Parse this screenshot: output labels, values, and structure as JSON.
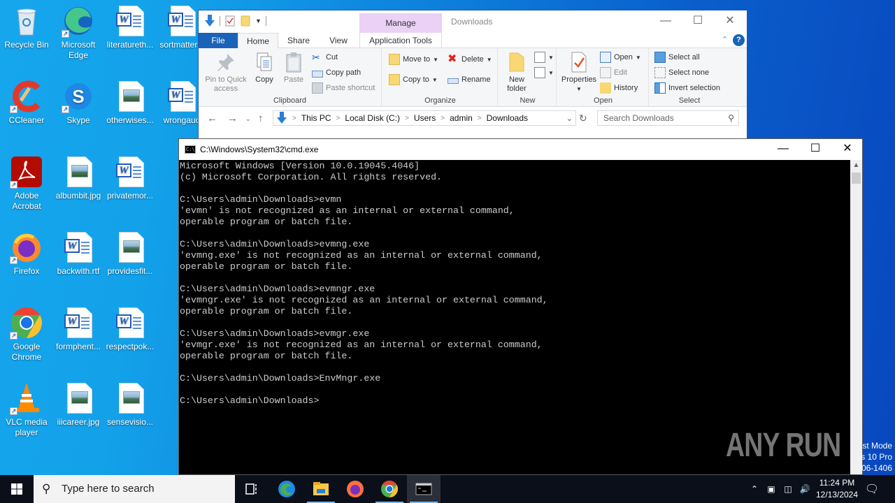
{
  "desktop": {
    "icons": [
      {
        "label": "Recycle Bin",
        "kind": "recycle-bin"
      },
      {
        "label": "Microsoft Edge",
        "kind": "edge"
      },
      {
        "label": "literatureth...",
        "kind": "word"
      },
      {
        "label": "sortmatter...",
        "kind": "word"
      },
      {
        "label": "CCleaner",
        "kind": "ccleaner"
      },
      {
        "label": "Skype",
        "kind": "skype"
      },
      {
        "label": "otherwises...",
        "kind": "image"
      },
      {
        "label": "wrongaud",
        "kind": "word"
      },
      {
        "label": "Adobe Acrobat",
        "kind": "acrobat"
      },
      {
        "label": "albumbit.jpg",
        "kind": "image"
      },
      {
        "label": "privatemor...",
        "kind": "word"
      },
      {
        "label": "Firefox",
        "kind": "firefox"
      },
      {
        "label": "backwith.rtf",
        "kind": "word"
      },
      {
        "label": "providesfit...",
        "kind": "image"
      },
      {
        "label": "Google Chrome",
        "kind": "chrome"
      },
      {
        "label": "formphent...",
        "kind": "word"
      },
      {
        "label": "respectpok...",
        "kind": "word"
      },
      {
        "label": "VLC media player",
        "kind": "vlc"
      },
      {
        "label": "iiicareer.jpg",
        "kind": "image"
      },
      {
        "label": "sensevisio...",
        "kind": "image"
      }
    ]
  },
  "explorer": {
    "title": "Downloads",
    "context_tab": "Manage",
    "tabs": {
      "file": "File",
      "home": "Home",
      "share": "Share",
      "view": "View",
      "app_tools": "Application Tools"
    },
    "ribbon": {
      "clipboard": {
        "label": "Clipboard",
        "pin": "Pin to Quick access",
        "copy": "Copy",
        "paste": "Paste",
        "cut": "Cut",
        "copy_path": "Copy path",
        "paste_shortcut": "Paste shortcut"
      },
      "organize": {
        "label": "Organize",
        "move_to": "Move to",
        "copy_to": "Copy to",
        "delete": "Delete",
        "rename": "Rename"
      },
      "new": {
        "label": "New",
        "new_folder": "New folder"
      },
      "open": {
        "label": "Open",
        "properties": "Properties",
        "open": "Open",
        "edit": "Edit",
        "history": "History"
      },
      "select": {
        "label": "Select",
        "select_all": "Select all",
        "select_none": "Select none",
        "invert": "Invert selection"
      }
    },
    "breadcrumb": [
      "This PC",
      "Local Disk (C:)",
      "Users",
      "admin",
      "Downloads"
    ],
    "search_placeholder": "Search Downloads"
  },
  "cmd": {
    "title": "C:\\Windows\\System32\\cmd.exe",
    "lines": [
      "Microsoft Windows [Version 10.0.19045.4046]",
      "(c) Microsoft Corporation. All rights reserved.",
      "",
      "C:\\Users\\admin\\Downloads>evmn",
      "'evmn' is not recognized as an internal or external command,",
      "operable program or batch file.",
      "",
      "C:\\Users\\admin\\Downloads>evmng.exe",
      "'evmng.exe' is not recognized as an internal or external command,",
      "operable program or batch file.",
      "",
      "C:\\Users\\admin\\Downloads>evmngr.exe",
      "'evmngr.exe' is not recognized as an internal or external command,",
      "operable program or batch file.",
      "",
      "C:\\Users\\admin\\Downloads>evmgr.exe",
      "'evmgr.exe' is not recognized as an internal or external command,",
      "operable program or batch file.",
      "",
      "C:\\Users\\admin\\Downloads>EnvMngr.exe",
      "",
      "C:\\Users\\admin\\Downloads>"
    ]
  },
  "watermark": {
    "text": "ANY RUN"
  },
  "test_mode": [
    "st Mode",
    "s 10 Pro",
    "06-1406"
  ],
  "taskbar": {
    "search_placeholder": "Type here to search",
    "pinned": [
      "task-view",
      "edge",
      "file-explorer",
      "firefox",
      "chrome",
      "cmd"
    ],
    "clock": {
      "time": "11:24 PM",
      "date": "12/13/2024"
    }
  }
}
